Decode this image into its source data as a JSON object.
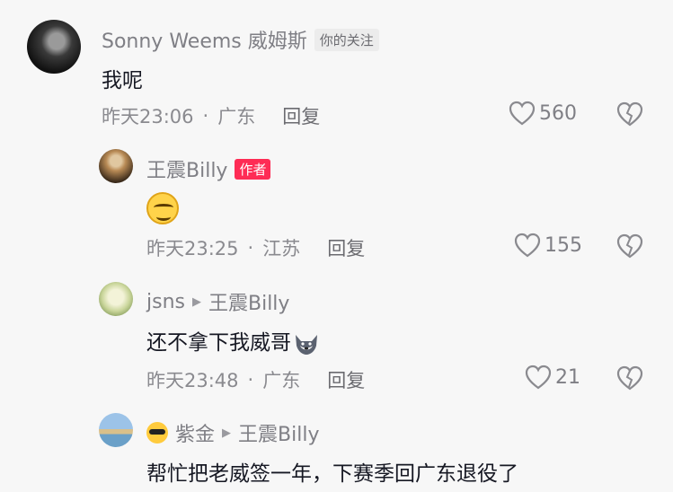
{
  "comments": [
    {
      "name": "Sonny Weems 威姆斯",
      "badge": "你的关注",
      "text": "我呢",
      "time": "昨天23:06",
      "location": "广东",
      "reply": "回复",
      "likes": "560"
    },
    {
      "name": "王震Billy",
      "badge": "作者",
      "emoji": "grinning-face-emoji",
      "time": "昨天23:25",
      "location": "江苏",
      "reply": "回复",
      "likes": "155"
    },
    {
      "name": "jsns",
      "reply_to": "王震Billy",
      "text": "还不拿下我威哥",
      "emoji": "wolf-emoji",
      "time": "昨天23:48",
      "location": "广东",
      "reply": "回复",
      "likes": "21"
    },
    {
      "name": "紫金",
      "reply_to": "王震Billy",
      "text": "帮忙把老威签一年，下赛季回广东退役了"
    }
  ],
  "separator": "·",
  "colors": {
    "author_badge": "#fe2c55",
    "secondary_text": "#8a8a8f",
    "background": "#f7f7f7"
  }
}
